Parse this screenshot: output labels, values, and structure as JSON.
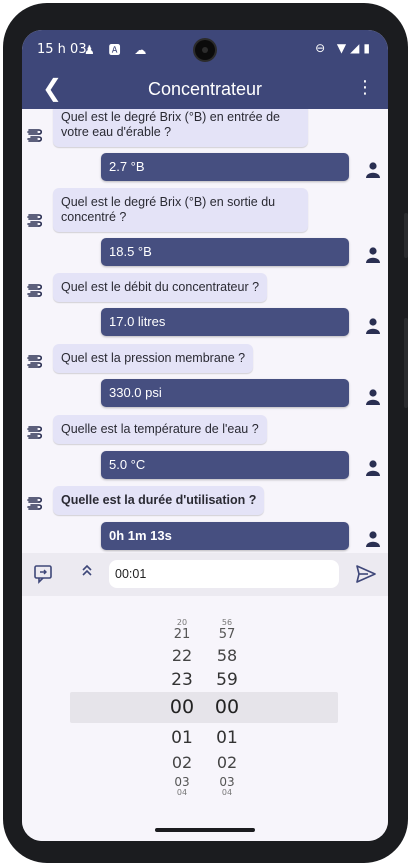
{
  "status_bar": {
    "time": "15 h 03",
    "left_icons": "♟ 🅰 ☁",
    "right_icons": "⊖ ▼◢▮"
  },
  "app_bar": {
    "title": "Concentrateur",
    "back_icon": "❮",
    "menu_icon": "⋮"
  },
  "conversation": [
    {
      "question": "Quel est le degré Brix (°B) en entrée de votre eau d'érable ?",
      "answer": "2.7 °B"
    },
    {
      "question": "Quel est le degré Brix (°B) en sortie du concentré ?",
      "answer": "18.5 °B"
    },
    {
      "question": "Quel est le débit du concentrateur ?",
      "answer": "17.0 litres"
    },
    {
      "question": "Quel est la pression membrane ?",
      "answer": "330.0 psi"
    },
    {
      "question": "Quelle est la température de l'eau ?",
      "answer": "5.0 °C"
    },
    {
      "question": "Quelle est la durée d'utilisation ?",
      "answer": "0h 1m 13s"
    }
  ],
  "input_bar": {
    "value": "00:01",
    "expand_icon": "˄"
  },
  "time_picker": {
    "hours": [
      "20",
      "21",
      "22",
      "23",
      "00",
      "01",
      "02",
      "03",
      "04"
    ],
    "minutes": [
      "56",
      "57",
      "58",
      "59",
      "00",
      "01",
      "02",
      "03",
      "04"
    ],
    "selected_hour": "00",
    "selected_minute": "00"
  },
  "colors": {
    "primary": "#3e4779",
    "user_bubble": "#464f80",
    "bot_bubble": "#e4e3f7"
  }
}
